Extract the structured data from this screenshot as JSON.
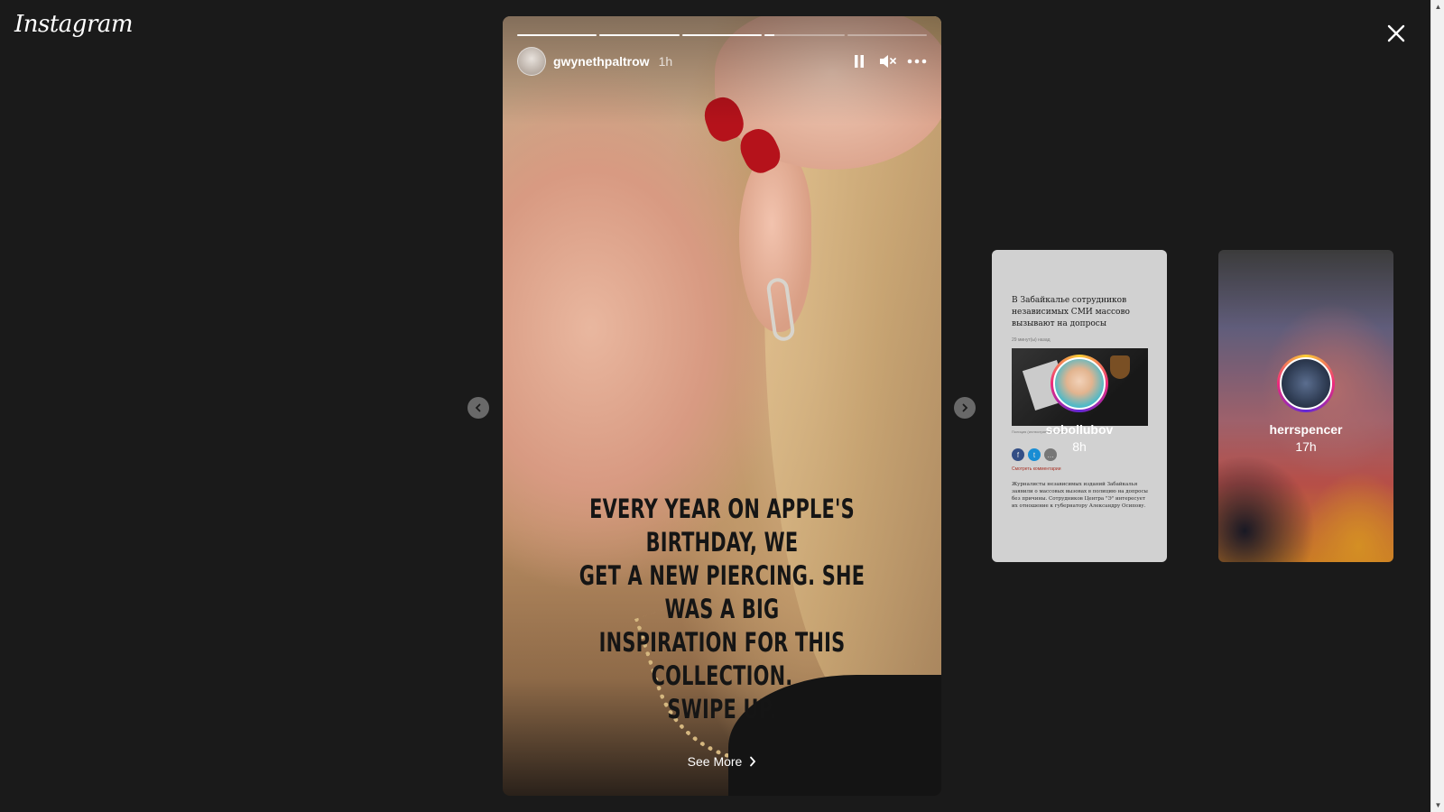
{
  "app": {
    "logo": "Instagram"
  },
  "colors": {
    "background": "#1a1a1a",
    "nail_polish": "#b5121b",
    "progress_active": "#ffffff"
  },
  "story": {
    "username": "gwynethpaltrow",
    "time": "1h",
    "caption": [
      "EVERY YEAR ON APPLE'S BIRTHDAY, WE",
      "GET A NEW PIERCING. SHE WAS A BIG",
      "INSPIRATION FOR THIS COLLECTION.",
      "SWIPE UP."
    ],
    "see_more": "See More",
    "progress": [
      1,
      1,
      1,
      0.12,
      0
    ],
    "controls": {
      "pause_icon": "pause-icon",
      "mute_icon": "volume-muted-icon",
      "more_icon": "more-horizontal-icon"
    }
  },
  "side_stories": [
    {
      "username": "sobollubov",
      "time": "8h",
      "preview": {
        "title": "В Забайкалье сотрудников независимых СМИ массово вызывают на допросы",
        "meta": "29 минут(ы) назад",
        "caption": "Полиция (иллюстративное фото)",
        "comments": "Смотреть комментарии",
        "body": "Журналисты независимых изданий Забайкалья заявили о массовых вызовах в полицию на допросы без причины. Сотрудников Центра \"Э\" интересует их отношение к губернатору Александру Осипову."
      }
    },
    {
      "username": "herrspencer",
      "time": "17h"
    }
  ],
  "icons": [
    "close-icon",
    "chevron-left-icon",
    "chevron-right-icon"
  ]
}
